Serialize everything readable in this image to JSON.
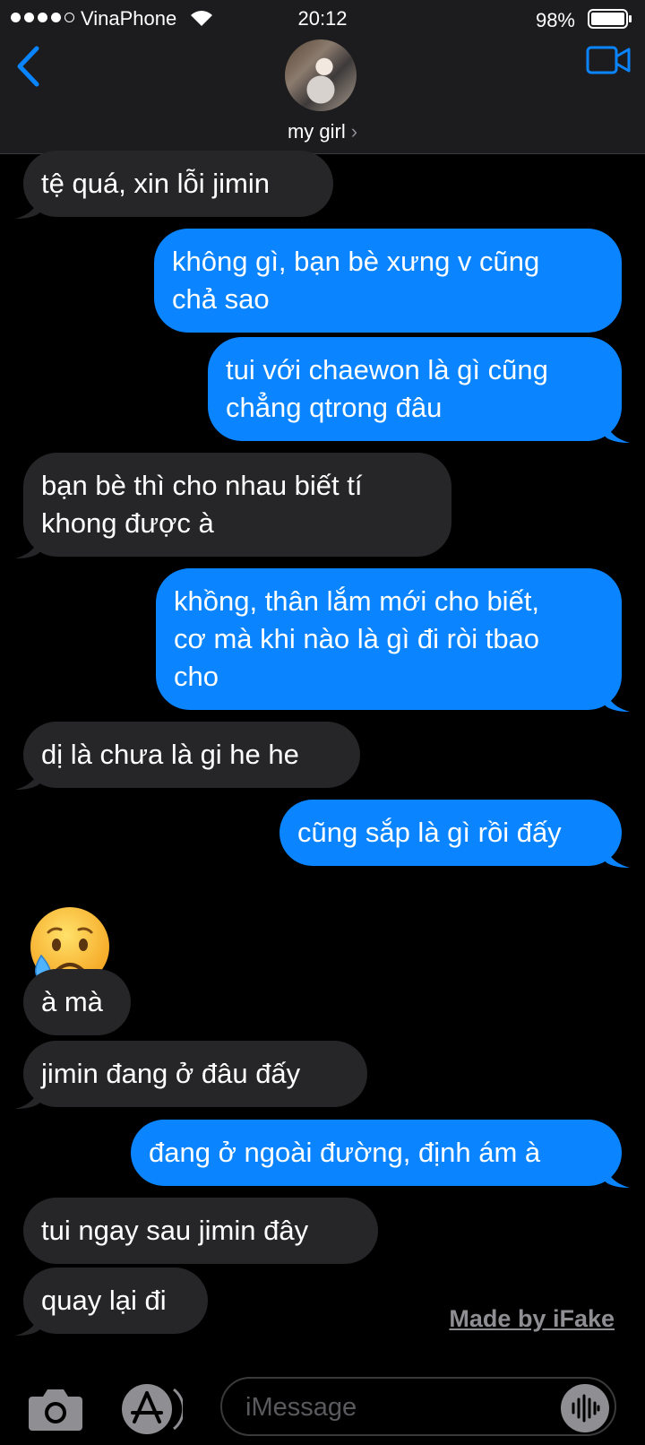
{
  "status_bar": {
    "carrier": "VinaPhone",
    "time": "20:12",
    "battery": "98%",
    "signal_bars_filled": 4,
    "signal_bars_total": 5
  },
  "header": {
    "contact_name": "my girl",
    "back_icon": "chevron-left-icon",
    "video_icon": "video-camera-icon",
    "accent_color": "#0a84ff"
  },
  "messages": [
    {
      "side": "received",
      "lines": [
        "tệ quá, xin lỗi jimin"
      ]
    },
    {
      "side": "sent",
      "lines": [
        "không gì, bạn bè xưng v cũng",
        "chả sao"
      ]
    },
    {
      "side": "sent",
      "lines": [
        "tui với chaewon là gì cũng",
        "chẳng qtrong đâu"
      ]
    },
    {
      "side": "received",
      "lines": [
        "bạn bè thì cho nhau biết tí",
        "khong được à"
      ]
    },
    {
      "side": "sent",
      "lines": [
        "khồng, thân lắm mới cho biết,",
        "cơ mà khi nào là gì đi ròi tbao",
        "cho"
      ]
    },
    {
      "side": "received",
      "lines": [
        "dị là chưa là gi he he"
      ]
    },
    {
      "side": "sent",
      "lines": [
        "cũng sắp là gì rồi đấy"
      ]
    },
    {
      "side": "received",
      "emoji": "sad-but-relieved-face-emoji"
    },
    {
      "side": "received",
      "lines": [
        "à mà"
      ]
    },
    {
      "side": "received",
      "lines": [
        "jimin đang ở đâu đấy"
      ]
    },
    {
      "side": "sent",
      "lines": [
        "đang ở ngoài đường, định ám à"
      ]
    },
    {
      "side": "received",
      "lines": [
        "tui ngay sau jimin đây"
      ]
    },
    {
      "side": "received",
      "lines": [
        "quay lại đi"
      ]
    }
  ],
  "watermark": "Made by iFake",
  "input_bar": {
    "placeholder": "iMessage",
    "camera_icon": "camera-icon",
    "apps_icon": "app-store-icon",
    "audio_icon": "audio-waveform-icon"
  },
  "colors": {
    "sent_bubble": "#0a84ff",
    "received_bubble": "#262628",
    "background": "#000000"
  }
}
